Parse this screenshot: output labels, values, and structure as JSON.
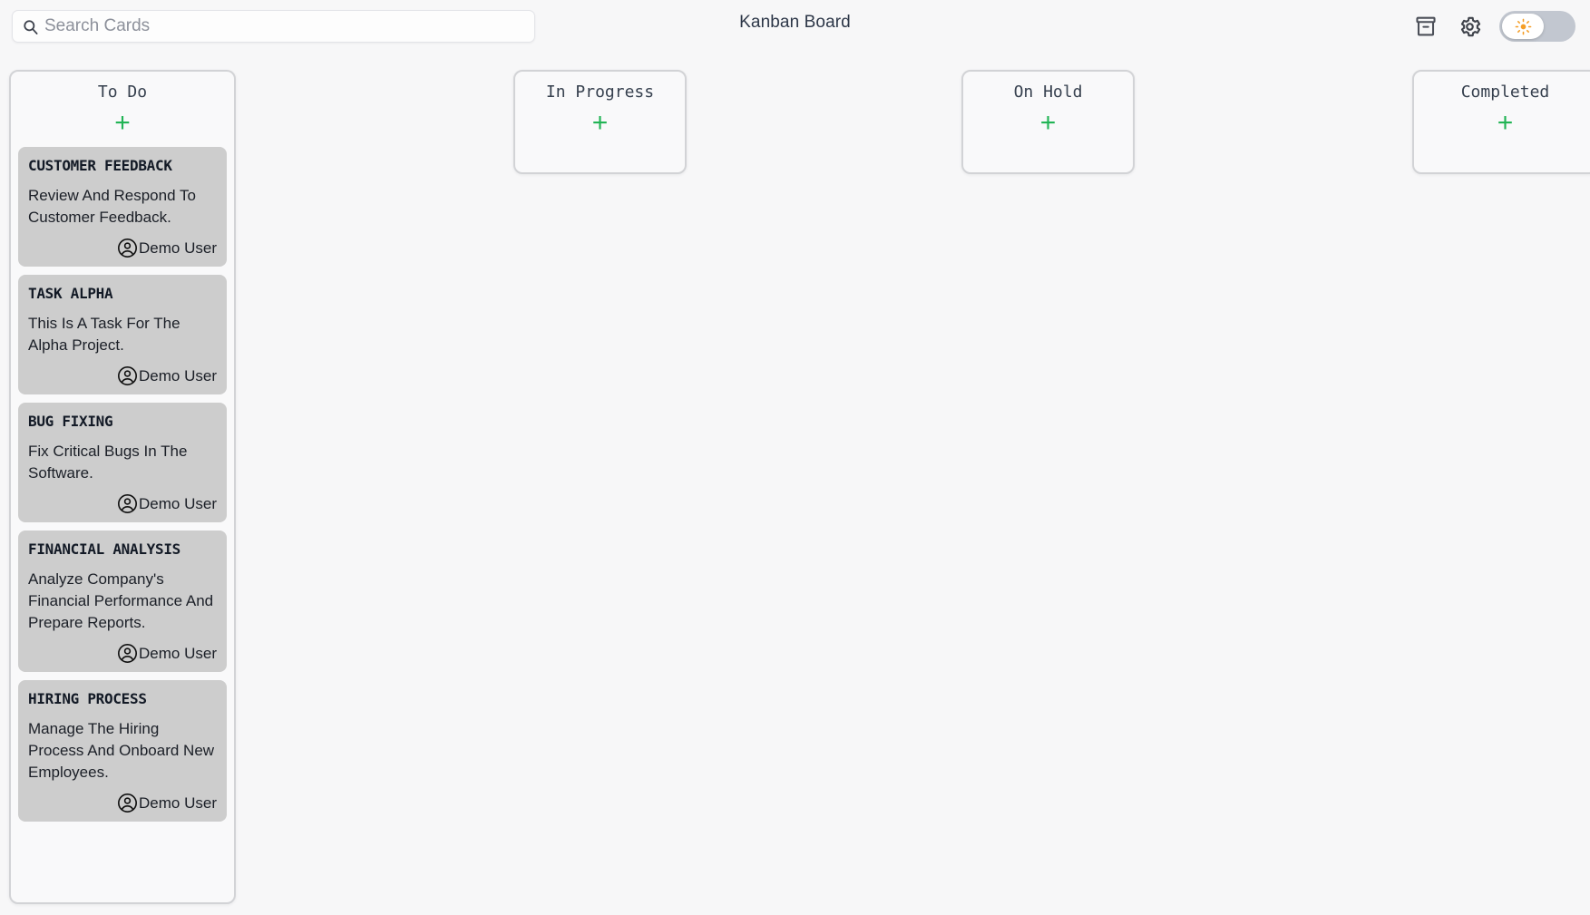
{
  "header": {
    "title": "Kanban Board",
    "search": {
      "placeholder": "Search Cards",
      "value": "",
      "icon": "search-icon"
    },
    "archive_button": {
      "icon": "archive-icon",
      "label": "Archive"
    },
    "settings_button": {
      "icon": "gear-icon",
      "label": "Settings"
    },
    "theme_toggle": {
      "icon": "sun-icon",
      "state": "light",
      "label": "Toggle theme"
    }
  },
  "colors": {
    "page_background": "#f7f7f8",
    "column_background": "#f9f9fa",
    "column_border": "#d2d3d6",
    "card_background": "#cdcdcd",
    "add_button_green": "#22b455",
    "title_text": "#2d3748",
    "toggle_track": "#c2c7d0",
    "toggle_knob": "#ffffff",
    "sun_icon": "#f59e26"
  },
  "board": {
    "add_card_label": "+",
    "columns": [
      {
        "title": "To Do",
        "cards": [
          {
            "title": "CUSTOMER FEEDBACK",
            "description": "Review And Respond To Customer Feedback.",
            "assignee": "Demo User"
          },
          {
            "title": "TASK ALPHA",
            "description": "This Is A Task For The Alpha Project.",
            "assignee": "Demo User"
          },
          {
            "title": "BUG FIXING",
            "description": "Fix Critical Bugs In The Software.",
            "assignee": "Demo User"
          },
          {
            "title": "FINANCIAL ANALYSIS",
            "description": "Analyze Company's Financial Performance And Prepare Reports.",
            "assignee": "Demo User"
          },
          {
            "title": "HIRING PROCESS",
            "description": "Manage The Hiring Process And Onboard New Employees.",
            "assignee": "Demo User"
          }
        ]
      },
      {
        "title": "In Progress",
        "cards": []
      },
      {
        "title": "On Hold",
        "cards": []
      },
      {
        "title": "Completed",
        "cards": []
      }
    ]
  }
}
